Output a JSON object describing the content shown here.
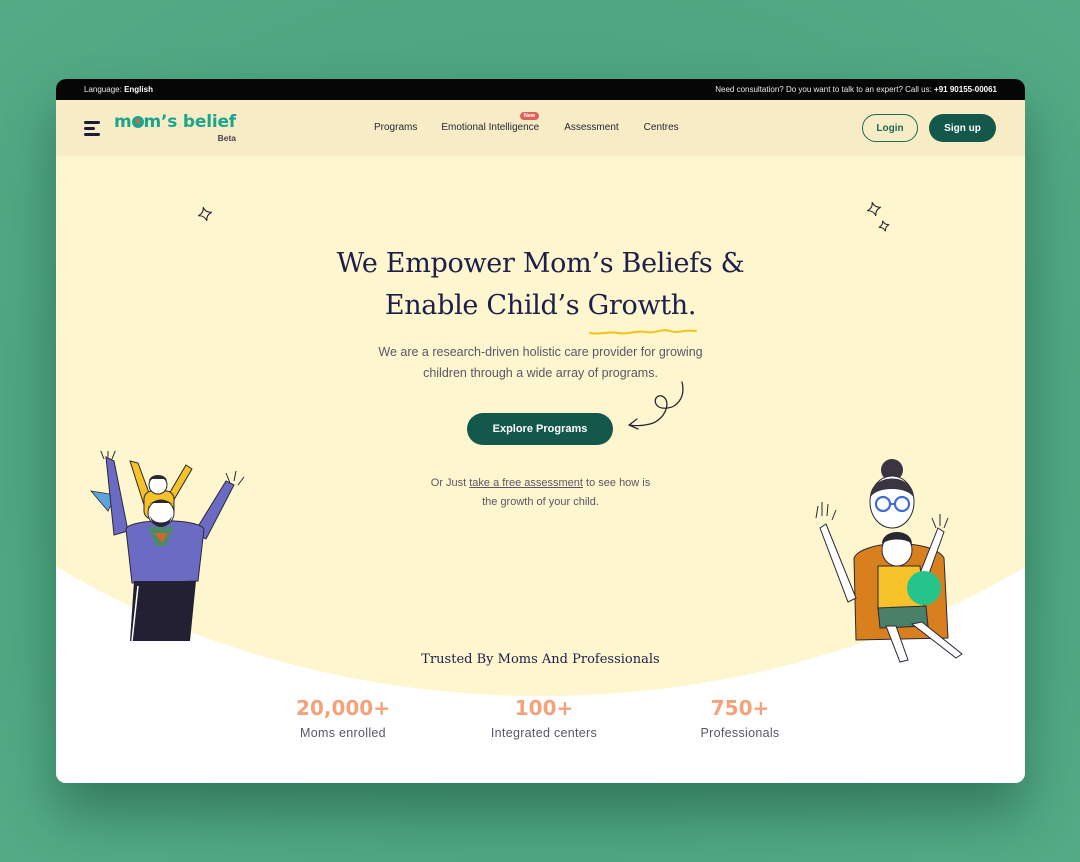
{
  "topbar": {
    "language_label": "Language:",
    "language_value": "English",
    "consult_text": "Need consultation? Do you want to talk to an expert? Call us:",
    "phone": "+91 90155-00061"
  },
  "nav": {
    "logo_text": "m m’s belief",
    "logo_prefix": "m",
    "logo_suffix": "m’s belief",
    "logo_badge": "Beta",
    "menu": [
      {
        "label": "Programs"
      },
      {
        "label": "Emotional Intelligence",
        "badge": "New"
      },
      {
        "label": "Assessment"
      },
      {
        "label": "Centres"
      }
    ],
    "login_label": "Login",
    "signup_label": "Sign up"
  },
  "hero": {
    "title_line1": "We Empower Mom’s Beliefs &",
    "title_line2": "Enable Child’s Growth.",
    "subtitle_line1": "We are a research-driven holistic care provider for growing",
    "subtitle_line2": "children through a wide array of programs.",
    "cta_label": "Explore Programs",
    "alt_prefix": "Or Just",
    "alt_link": "take a free assessment",
    "alt_suffix": "to see how is",
    "alt_line2": "the growth of your child."
  },
  "trust": {
    "heading": "Trusted By Moms And Professionals",
    "stats": [
      {
        "value": "20,000+",
        "label": "Moms enrolled"
      },
      {
        "value": "100+",
        "label": "Integrated centers"
      },
      {
        "value": "750+",
        "label": "Professionals"
      }
    ]
  },
  "colors": {
    "brand_green": "#13584a",
    "logo_teal": "#1aa58c",
    "hero_bg": "#fef6cf",
    "nav_bg": "#f7ecc6",
    "stat_orange": "#f3a27a",
    "heading_navy": "#1d1e4a",
    "badge_red": "#e0605a"
  }
}
